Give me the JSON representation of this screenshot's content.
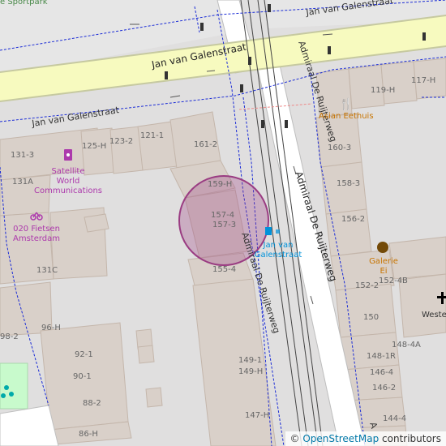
{
  "map": {
    "streets": {
      "jan_van_galenstraat_main": "Jan van Galenstraat",
      "jan_van_galenstraat_side": "Jan van Galenstraat",
      "jan_van_galenstraat_top": "Jan van Galenstraat",
      "admiraal_de_ruijterweg_main": "Admiraal De Ruijterweg",
      "admiraal_de_ruijterweg_west": "Admiraal De Ruijterweg",
      "admiraal_de_ruijterweg_east": "Admiraal De Ruijterweg",
      "admiraal_cut": "A",
      "sportpark": "e Sportpark"
    },
    "pois": {
      "asian_eethuis": "Asian Eethuis",
      "satellite_1": "Satellite",
      "satellite_2": "World",
      "satellite_3": "Communications",
      "fietsen_1": "020 Fietsen",
      "fietsen_2": "Amsterdam",
      "tram_stop_1": "Jan van",
      "tram_stop_2": "Galenstraat",
      "galerie_1": "Galerie",
      "galerie_2": "Ei",
      "weste": "Weste"
    },
    "house_numbers": {
      "n131_3": "131-3",
      "n125_h": "125-H",
      "n123_2": "123-2",
      "n121_1": "121-1",
      "n161_2": "161-2",
      "n131a": "131A",
      "n159_h": "159-H",
      "n157_4": "157-4",
      "n157_3": "157-3",
      "n155_4": "155-4",
      "n131c": "131C",
      "n98_2": "98-2",
      "n96_h": "96-H",
      "n92_1": "92-1",
      "n90_1": "90-1",
      "n88_2": "88-2",
      "n86_h": "86-H",
      "n149_1": "149-1",
      "n149_h": "149-H",
      "n147_h": "147-H",
      "n119_h": "119-H",
      "n117_h": "117-H",
      "n160_3": "160-3",
      "n158_3": "158-3",
      "n156_2": "156-2",
      "n152_2": "152-2",
      "n152_4b": "152-4B",
      "n150": "150",
      "n148_4a": "148-4A",
      "n148_1r": "148-1R",
      "n146_4": "146-4",
      "n146_2": "146-2",
      "n144_4": "144-4"
    }
  },
  "attribution": {
    "copyright": "© ",
    "link": "OpenStreetMap",
    "suffix": " contributors"
  },
  "colors": {
    "road_yellow": "#f7fabf",
    "road_casing": "#c6c9a0",
    "building": "#d9d0c9",
    "building_stroke": "#c4b6ab",
    "background": "#e0dfdf",
    "footway": "#1a2bd6",
    "tram": "#444444",
    "highlight": "#9a3c82",
    "park": "#c8facc"
  }
}
